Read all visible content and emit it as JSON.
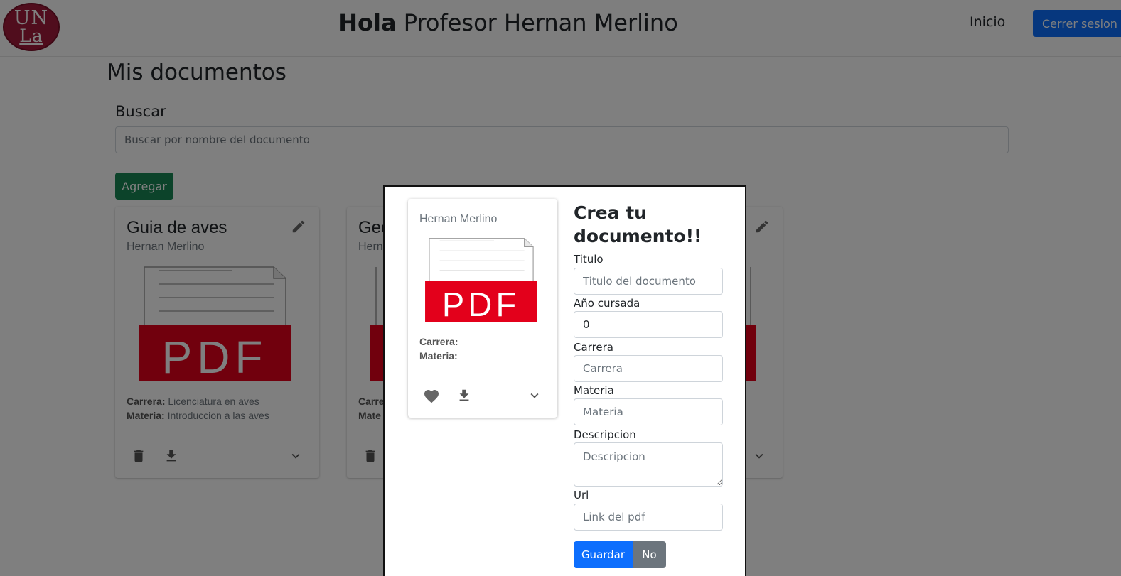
{
  "header": {
    "logo_line1": "UN",
    "logo_line2": "La",
    "greeting_bold": "Hola",
    "greeting_rest": " Profesor Hernan Merlino",
    "nav_home": "Inicio",
    "logout_label": "Cerrer sesion"
  },
  "page": {
    "title": "Mis documentos",
    "search_label": "Buscar",
    "search_placeholder": "Buscar por nombre del documento",
    "add_label": "Agregar"
  },
  "documents": [
    {
      "title": "Guia de aves",
      "author": "Hernan Merlino",
      "career_label": "Carrera:",
      "career": "Licenciatura en aves",
      "subject_label": "Materia:",
      "subject": "Introduccion a las aves"
    },
    {
      "title": "Geo",
      "author": "Hern",
      "career_label": "Carre",
      "career": "",
      "subject_label": "Mate",
      "subject": ""
    }
  ],
  "pdf_icon_text": "PDF",
  "modal": {
    "preview": {
      "author": "Hernan Merlino",
      "career_label": "Carrera:",
      "subject_label": "Materia:"
    },
    "heading": "Crea tu documento!!",
    "fields": {
      "titulo": {
        "label": "Titulo",
        "placeholder": "Titulo del documento",
        "value": ""
      },
      "anio": {
        "label": "Año cursada",
        "value": "0"
      },
      "carrera": {
        "label": "Carrera",
        "placeholder": "Carrera",
        "value": ""
      },
      "materia": {
        "label": "Materia",
        "placeholder": "Materia",
        "value": ""
      },
      "descripcion": {
        "label": "Descripcion",
        "placeholder": "Descripcion",
        "value": ""
      },
      "url": {
        "label": "Url",
        "placeholder": "Link del pdf",
        "value": ""
      }
    },
    "save_label": "Guardar",
    "cancel_label": "No"
  },
  "colors": {
    "primary": "#0d6efd",
    "success": "#198754",
    "secondary": "#6c757d",
    "pdf_red": "#e3001b",
    "logo": "#a01a3a"
  },
  "icons": [
    "edit-icon",
    "trash-icon",
    "download-icon",
    "chevron-down-icon",
    "heart-icon",
    "pdf-file-icon"
  ]
}
